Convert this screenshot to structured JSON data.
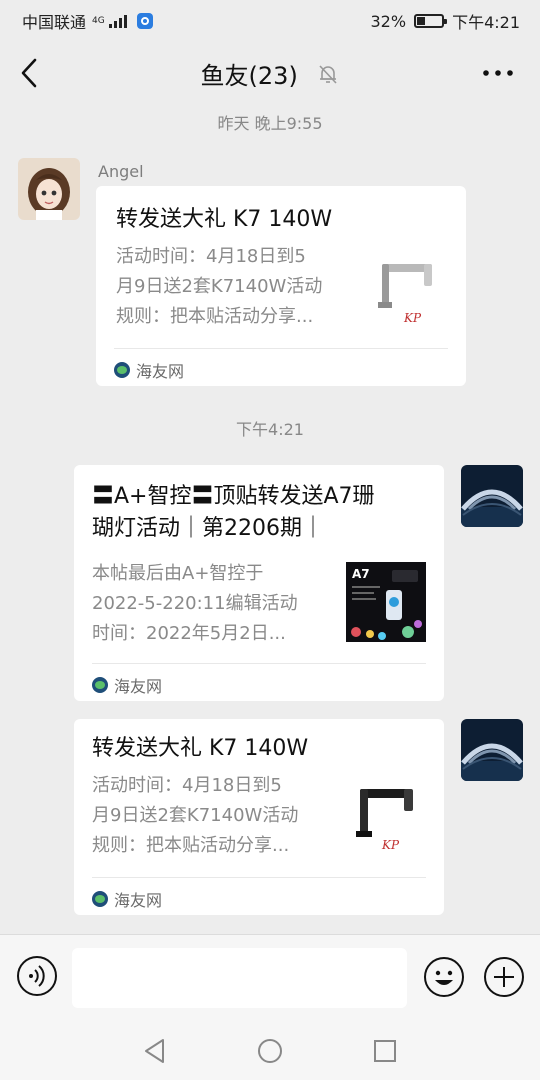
{
  "status_bar": {
    "carrier": "中国联通",
    "network": "4G",
    "battery_percent": "32%",
    "time": "下午4:21",
    "icons": [
      "signal-icon",
      "app-notification-icon",
      "battery-icon"
    ]
  },
  "header": {
    "title": "鱼友(23)",
    "icons": [
      "back-arrow-icon",
      "mute-bell-icon",
      "more-icon"
    ]
  },
  "messages": [
    {
      "timestamp": "昨天 晚上9:55",
      "sender": "Angel",
      "side": "left",
      "card": {
        "title": "转发送大礼 K7 140W",
        "desc_lines": [
          "活动时间：4月18日到5",
          "月9日送2套K7140W活动",
          "规则：把本贴活动分享..."
        ],
        "thumb": "light-fixture-thumbnail",
        "source": "海友网"
      }
    },
    {
      "timestamp": "下午4:21",
      "sender": "",
      "side": "right",
      "card": {
        "title_lines": [
          "〓A+智控〓顶贴转发送A7珊",
          "瑚灯活动｜第2206期｜"
        ],
        "desc_lines": [
          "本帖最后由A+智控于",
          "2022-5-220:11编辑活动",
          "时间：2022年5月2日..."
        ],
        "thumb": "a7-coral-lamp-thumbnail",
        "thumb_label": "A7",
        "source": "海友网"
      }
    },
    {
      "timestamp": "",
      "sender": "",
      "side": "right",
      "card": {
        "title": "转发送大礼 K7 140W",
        "desc_lines": [
          "活动时间：4月18日到5",
          "月9日送2套K7140W活动",
          "规则：把本贴活动分享..."
        ],
        "thumb": "light-fixture-thumbnail",
        "source": "海友网"
      }
    }
  ],
  "input_bar": {
    "value": "",
    "icons": [
      "voice-icon",
      "emoji-icon",
      "plus-icon"
    ]
  },
  "nav_bar": {
    "icons": [
      "nav-back-icon",
      "nav-home-icon",
      "nav-recents-icon"
    ]
  },
  "colors": {
    "background": "#ededed",
    "card": "#ffffff",
    "muted_text": "#8a8a8a"
  }
}
